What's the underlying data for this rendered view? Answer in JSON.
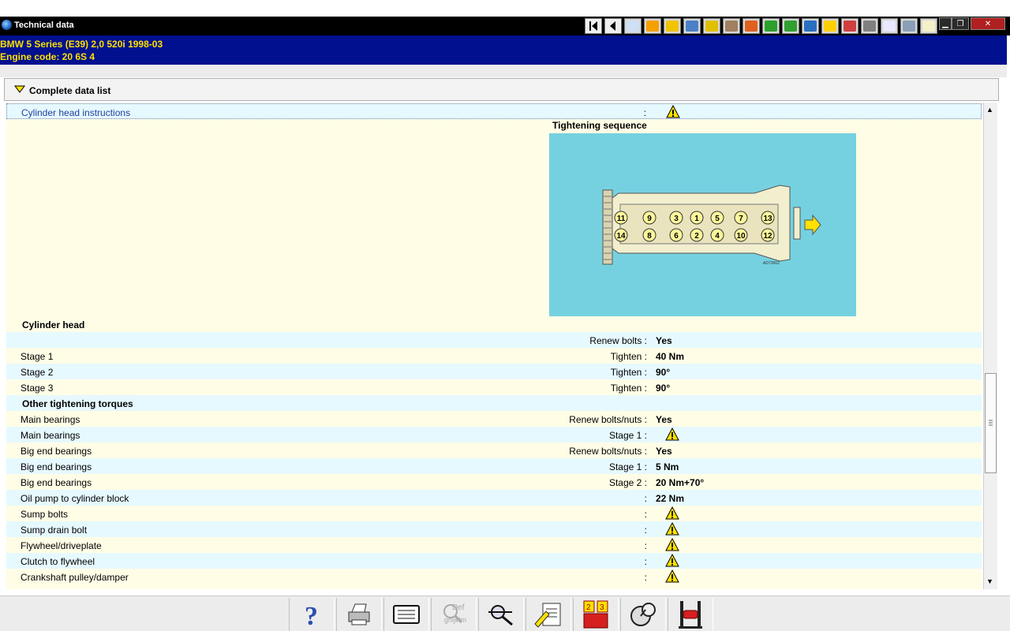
{
  "window": {
    "title": "Technical data"
  },
  "toolbar": {
    "nav_first": "first-page",
    "nav_prev": "previous-page",
    "icons": [
      "engine-data-icon",
      "ignition-icon",
      "fuel-icon",
      "wiring-icon",
      "timing-icon",
      "repair-icon",
      "lubrication-icon",
      "test-icon",
      "electrical-icon",
      "schematic-icon",
      "service-icon",
      "warning-lights-icon",
      "brake-icon",
      "alert-icon",
      "car-icon",
      "note-icon"
    ]
  },
  "vehicle": {
    "line1": "BMW   5 Series (E39) 2,0 520i 1998-03",
    "line2": "Engine code: 20 6S 4"
  },
  "section": {
    "title": "Complete data list"
  },
  "diagram": {
    "caption": "Tightening sequence",
    "image_code": "AD73662",
    "bolts_top": [
      "11",
      "9",
      "3",
      "1",
      "5",
      "7",
      "13"
    ],
    "bolts_bottom": [
      "14",
      "8",
      "6",
      "2",
      "4",
      "10",
      "12"
    ]
  },
  "rows": [
    {
      "label": "Cylinder head instructions",
      "mid": ":",
      "warn": true
    },
    {
      "label": "Cylinder head",
      "heading": true
    },
    {
      "label": "",
      "mid": "Renew bolts :",
      "value": "Yes"
    },
    {
      "label": "Stage 1",
      "mid": "Tighten :",
      "value": "40 Nm"
    },
    {
      "label": "Stage 2",
      "mid": "Tighten :",
      "value": "90°"
    },
    {
      "label": "Stage 3",
      "mid": "Tighten :",
      "value": "90°"
    },
    {
      "label": "Other tightening torques",
      "heading": true
    },
    {
      "label": "Main bearings",
      "mid": "Renew bolts/nuts :",
      "value": "Yes"
    },
    {
      "label": "Main bearings",
      "mid": "Stage 1 :",
      "warn": true
    },
    {
      "label": "Big end bearings",
      "mid": "Renew bolts/nuts :",
      "value": "Yes"
    },
    {
      "label": "Big end bearings",
      "mid": "Stage 1 :",
      "value": "5 Nm"
    },
    {
      "label": "Big end bearings",
      "mid": "Stage 2 :",
      "value": "20 Nm+70°"
    },
    {
      "label": "Oil pump to cylinder block",
      "mid": ":",
      "value": "22 Nm"
    },
    {
      "label": "Sump bolts",
      "mid": ":",
      "warn": true
    },
    {
      "label": "Sump drain bolt",
      "mid": ":",
      "warn": true
    },
    {
      "label": "Flywheel/driveplate",
      "mid": ":",
      "warn": true
    },
    {
      "label": "Clutch to flywheel",
      "mid": ":",
      "warn": true
    },
    {
      "label": "Crankshaft pulley/damper",
      "mid": ":",
      "warn": true
    }
  ],
  "bottom_toolbar": [
    "help-icon",
    "print-icon",
    "display-icon",
    "glossary-icon",
    "search-tools-icon",
    "notes-icon",
    "calendar-icon",
    "diagnostics-icon",
    "lift-icon"
  ],
  "bottom_labels": {
    "glossary_line1": "Def",
    "glossary_line2": "ghijklm"
  },
  "colors": {
    "title_bar": "#000000",
    "vehicle_bar": "#00108f",
    "vehicle_text": "#ffe000",
    "row_blue": "#e6f9ff",
    "row_cream": "#fffde6",
    "diagram_bg": "#75d1e0"
  }
}
